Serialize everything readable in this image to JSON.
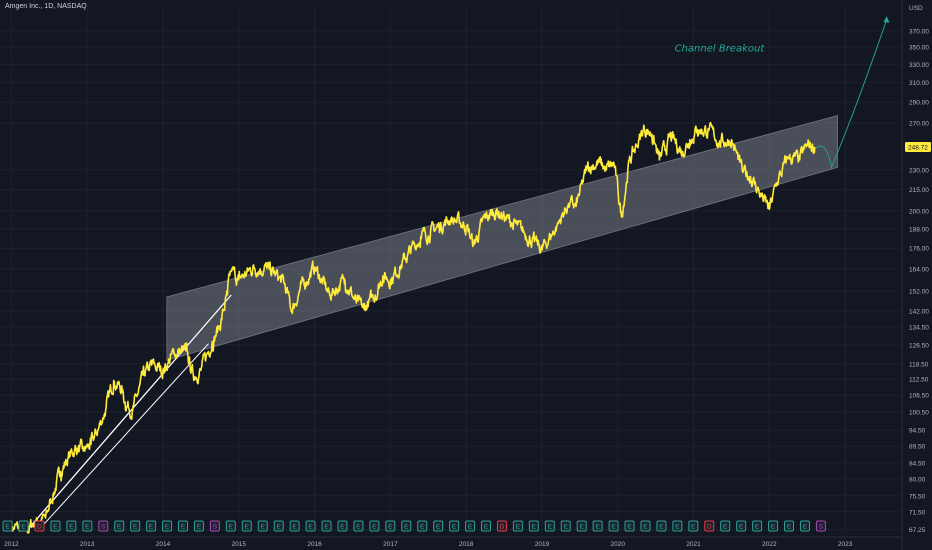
{
  "header": {
    "symbol_title": "Amgen Inc., 1D, NASDAQ"
  },
  "colors": {
    "background": "#131722",
    "price_line": "#ffeb3b",
    "channel_fill": "#b2b5be",
    "trend_line": "#ffffff",
    "annotation": "#26a69a",
    "last_price_badge": "#ffeb3b",
    "event_earnings": "#26a69a",
    "event_dividend": "#f23645",
    "event_split": "#ab47bc"
  },
  "chart_data": {
    "type": "line",
    "title": "Amgen Inc., 1D, NASDAQ",
    "xlabel": "",
    "ylabel": "USD",
    "y_scale": "log",
    "ylim": [
      66.5,
      400
    ],
    "xlim": [
      2011.85,
      2023.75
    ],
    "grid": true,
    "x_ticks": [
      "2012",
      "2013",
      "2014",
      "2015",
      "2016",
      "2017",
      "2018",
      "2019",
      "2020",
      "2021",
      "2022",
      "2023"
    ],
    "y_ticks": [
      "67.25",
      "71.50",
      "75.50",
      "80.00",
      "84.50",
      "89.50",
      "94.50",
      "100.50",
      "106.50",
      "112.50",
      "118.50",
      "126.50",
      "134.50",
      "142.00",
      "152.00",
      "164.00",
      "176.00",
      "188.00",
      "200.00",
      "215.00",
      "230.00",
      "248.72",
      "270.00",
      "290.00",
      "310.00",
      "330.00",
      "350.00",
      "370.00"
    ],
    "series": [
      {
        "x": [
          2012.0,
          2012.2,
          2012.3,
          2012.45,
          2012.55,
          2012.65,
          2012.75,
          2012.85,
          2012.95,
          2013.05,
          2013.15,
          2013.25,
          2013.35,
          2013.45,
          2013.5,
          2013.6,
          2013.75,
          2013.85,
          2014.0,
          2014.15,
          2014.3,
          2014.4,
          2014.5,
          2014.65,
          2014.75,
          2014.85,
          2014.9,
          2015.0,
          2015.2,
          2015.4,
          2015.6,
          2015.7,
          2015.8,
          2016.0,
          2016.2,
          2016.4,
          2016.55,
          2016.65,
          2016.8,
          2016.9,
          2017.0,
          2017.2,
          2017.4,
          2017.6,
          2017.8,
          2018.0,
          2018.1,
          2018.25,
          2018.4,
          2018.6,
          2018.75,
          2018.9,
          2019.0,
          2019.2,
          2019.35,
          2019.45,
          2019.6,
          2019.75,
          2019.85,
          2019.95,
          2020.05,
          2020.15,
          2020.25,
          2020.35,
          2020.45,
          2020.55,
          2020.7,
          2020.85,
          2020.95,
          2021.05,
          2021.2,
          2021.35,
          2021.5,
          2021.65,
          2021.75,
          2021.9,
          2022.0,
          2022.1,
          2022.25,
          2022.4,
          2022.5,
          2022.6
        ],
        "values": [
          68,
          67,
          69,
          70,
          76,
          82,
          86,
          89,
          88,
          90,
          95,
          102,
          112,
          109,
          104,
          101,
          114,
          118,
          116,
          123,
          124,
          114,
          116,
          128,
          135,
          150,
          163,
          158,
          165,
          164,
          156,
          142,
          152,
          165,
          150,
          158,
          146,
          143,
          150,
          160,
          158,
          170,
          183,
          188,
          195,
          190,
          178,
          195,
          200,
          192,
          186,
          180,
          175,
          190,
          205,
          203,
          232,
          236,
          230,
          235,
          196,
          237,
          250,
          265,
          260,
          238,
          257,
          245,
          255,
          264,
          263,
          253,
          255,
          228,
          225,
          210,
          201,
          220,
          240,
          238,
          250,
          248.72
        ],
        "name": ""
      }
    ],
    "last_price": 248.72,
    "annotations": [
      "Channel Breakout"
    ],
    "event_flags": [
      "E",
      "E",
      "D",
      "E",
      "E",
      "E",
      "S",
      "E",
      "E",
      "E",
      "E",
      "E",
      "E",
      "S",
      "E",
      "E",
      "E",
      "E",
      "E",
      "E",
      "E",
      "E",
      "E",
      "E",
      "E",
      "E",
      "E",
      "E",
      "E",
      "E",
      "E",
      "D",
      "E",
      "E",
      "E",
      "E",
      "E",
      "E",
      "E",
      "E",
      "E",
      "E",
      "E",
      "E",
      "D",
      "E",
      "E",
      "E",
      "E",
      "E",
      "E",
      "S"
    ]
  }
}
